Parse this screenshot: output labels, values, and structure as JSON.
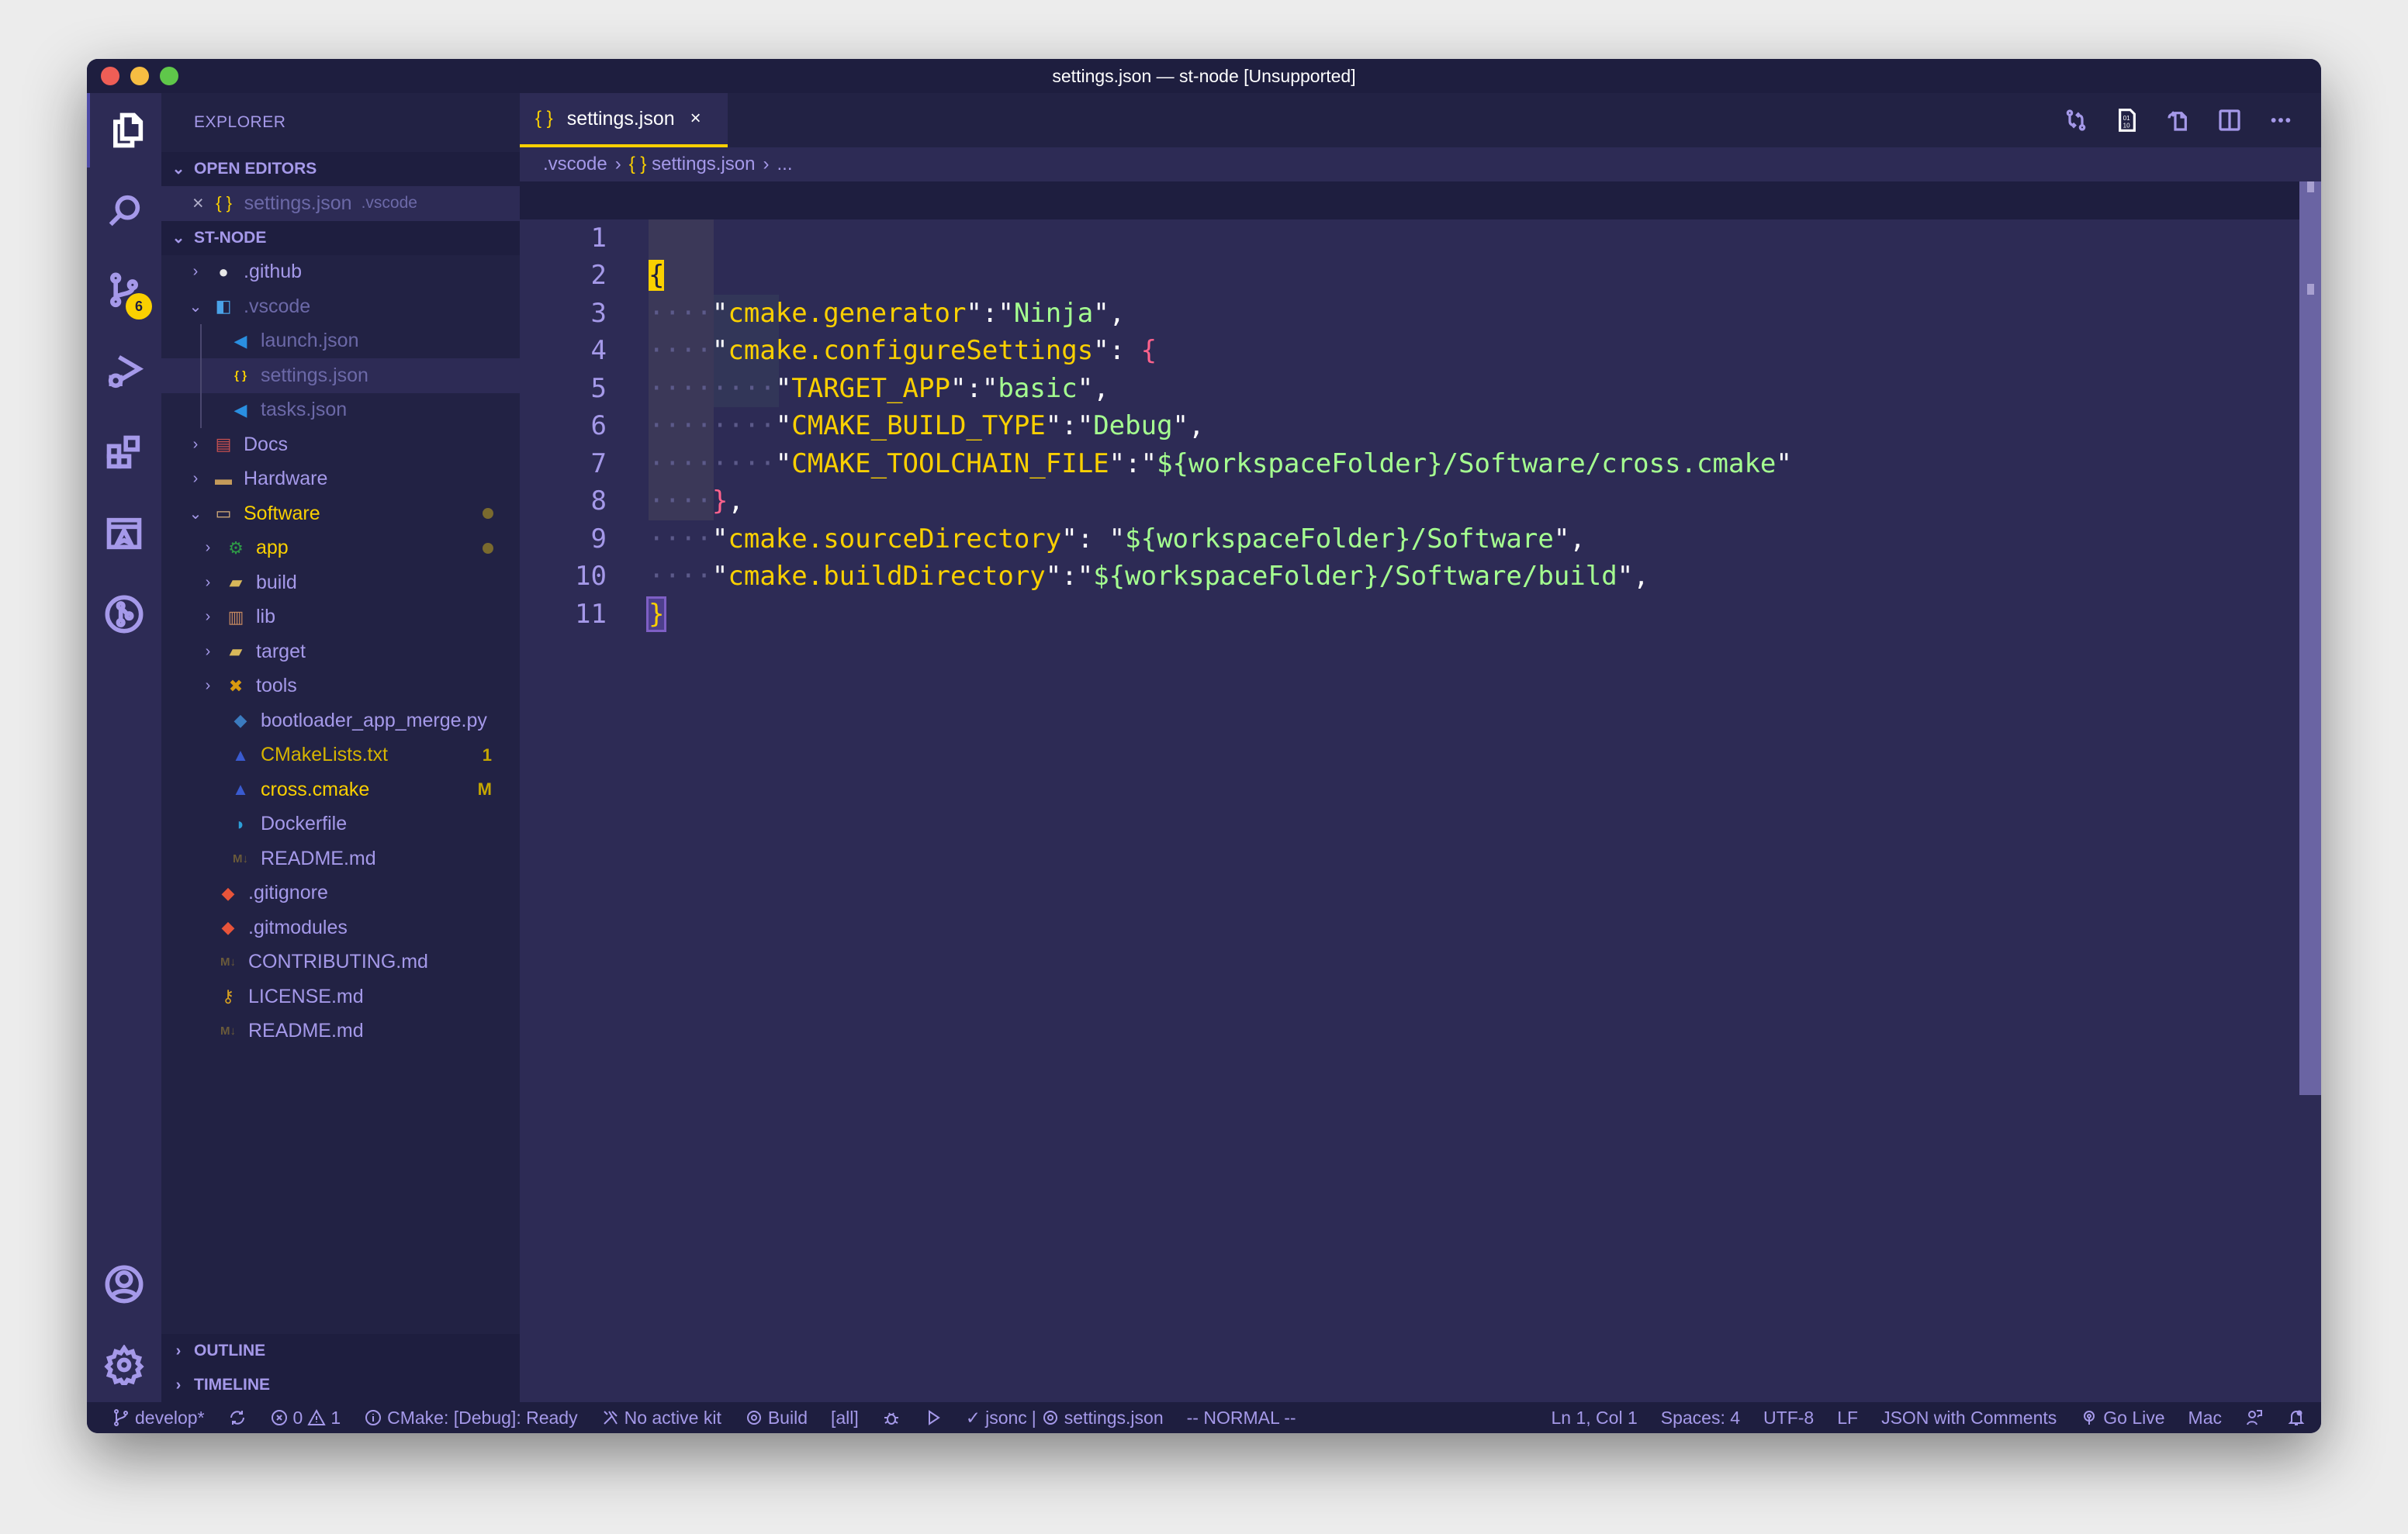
{
  "window": {
    "title": "settings.json — st-node [Unsupported]"
  },
  "activity_bar": {
    "items": [
      {
        "name": "explorer",
        "icon": "files-icon",
        "active": true
      },
      {
        "name": "search",
        "icon": "search-icon"
      },
      {
        "name": "source-control",
        "icon": "source-control-icon",
        "badge": "6"
      },
      {
        "name": "run-debug",
        "icon": "run-debug-icon"
      },
      {
        "name": "extensions",
        "icon": "extensions-icon"
      },
      {
        "name": "cmake",
        "icon": "cmake-icon"
      },
      {
        "name": "git-graph",
        "icon": "git-graph-icon"
      }
    ],
    "bottom": [
      {
        "name": "accounts",
        "icon": "account-icon"
      },
      {
        "name": "manage",
        "icon": "gear-icon"
      }
    ]
  },
  "sidebar": {
    "title": "EXPLORER",
    "open_editors": {
      "label": "OPEN EDITORS",
      "items": [
        {
          "close": "×",
          "icon": "{ }",
          "name": "settings.json",
          "folder": ".vscode"
        }
      ]
    },
    "workspace": {
      "label": "ST-NODE",
      "tree": [
        {
          "name": ".github",
          "type": "folder",
          "icon": "github-folder-icon",
          "expanded": false
        },
        {
          "name": ".vscode",
          "type": "folder",
          "icon": "vscode-folder-icon",
          "expanded": true
        },
        {
          "name": "launch.json",
          "type": "file",
          "icon": "vscode-icon"
        },
        {
          "name": "settings.json",
          "type": "file",
          "icon": "json-icon",
          "selected": true
        },
        {
          "name": "tasks.json",
          "type": "file",
          "icon": "vscode-icon"
        },
        {
          "name": "Docs",
          "type": "folder",
          "icon": "docs-folder-icon",
          "expanded": false
        },
        {
          "name": "Hardware",
          "type": "folder",
          "icon": "folder-icon",
          "expanded": false
        },
        {
          "name": "Software",
          "type": "folder",
          "icon": "folder-open-icon",
          "expanded": true,
          "modified_dot": true
        },
        {
          "name": "app",
          "type": "folder",
          "icon": "app-folder-icon",
          "expanded": false,
          "modified_dot": true
        },
        {
          "name": "build",
          "type": "folder",
          "icon": "build-folder-icon",
          "expanded": false
        },
        {
          "name": "lib",
          "type": "folder",
          "icon": "lib-folder-icon",
          "expanded": false
        },
        {
          "name": "target",
          "type": "folder",
          "icon": "target-folder-icon",
          "expanded": false
        },
        {
          "name": "tools",
          "type": "folder",
          "icon": "tools-folder-icon",
          "expanded": false
        },
        {
          "name": "bootloader_app_merge.py",
          "type": "file",
          "icon": "python-icon"
        },
        {
          "name": "CMakeLists.txt",
          "type": "file",
          "icon": "cmake-file-icon",
          "decoration": "1"
        },
        {
          "name": "cross.cmake",
          "type": "file",
          "icon": "cmake-file-icon",
          "decoration": "M"
        },
        {
          "name": "Dockerfile",
          "type": "file",
          "icon": "docker-icon"
        },
        {
          "name": "README.md",
          "type": "file",
          "icon": "markdown-icon"
        },
        {
          "name": ".gitignore",
          "type": "file",
          "icon": "git-icon"
        },
        {
          "name": ".gitmodules",
          "type": "file",
          "icon": "git-icon"
        },
        {
          "name": "CONTRIBUTING.md",
          "type": "file",
          "icon": "markdown-icon"
        },
        {
          "name": "LICENSE.md",
          "type": "file",
          "icon": "license-key-icon"
        },
        {
          "name": "README.md",
          "type": "file",
          "icon": "markdown-icon"
        }
      ]
    },
    "outline_label": "OUTLINE",
    "timeline_label": "TIMELINE"
  },
  "editor": {
    "tab": {
      "icon": "{ }",
      "label": "settings.json",
      "close": "×"
    },
    "toolbar": [
      "open-changes-icon",
      "binary-file-icon",
      "open-file-icon",
      "split-editor-icon",
      "more-actions-icon"
    ],
    "breadcrumb": [
      ".vscode",
      "{ }",
      "settings.json",
      "..."
    ],
    "lines": [
      {
        "n": "1"
      },
      {
        "n": "2",
        "key": "cmake.generator",
        "value": "Ninja"
      },
      {
        "n": "3",
        "key": "cmake.configureSettings"
      },
      {
        "n": "4",
        "key": "TARGET_APP",
        "value": "basic"
      },
      {
        "n": "5",
        "key": "CMAKE_BUILD_TYPE",
        "value": "Debug"
      },
      {
        "n": "6",
        "key": "CMAKE_TOOLCHAIN_FILE",
        "value": "${workspaceFolder}/Software/cross.cmake"
      },
      {
        "n": "7"
      },
      {
        "n": "8",
        "key": "cmake.sourceDirectory",
        "value": "${workspaceFolder}/Software"
      },
      {
        "n": "9",
        "key": "cmake.buildDirectory",
        "value": "${workspaceFolder}/Software/build"
      },
      {
        "n": "10"
      },
      {
        "n": "11"
      }
    ]
  },
  "statusbar": {
    "branch": "develop*",
    "errors": "0",
    "warnings": "1",
    "cmake_status": "CMake: [Debug]: Ready",
    "kit": "No active kit",
    "build": "Build",
    "target": "[all]",
    "lang_check": "jsonc",
    "schema_file": "settings.json",
    "vim_mode": "-- NORMAL --",
    "position": "Ln 1, Col 1",
    "indent": "Spaces: 4",
    "encoding": "UTF-8",
    "eol": "LF",
    "language": "JSON with Comments",
    "go_live": "Go Live",
    "platform": "Mac"
  },
  "colors": {
    "accent": "#fad000",
    "background": "#2d2b55",
    "sidebar": "#222244",
    "dark": "#1e1e3f",
    "foreground": "#a599e9",
    "string": "#a5ff90",
    "bracket2": "#ff628c"
  }
}
